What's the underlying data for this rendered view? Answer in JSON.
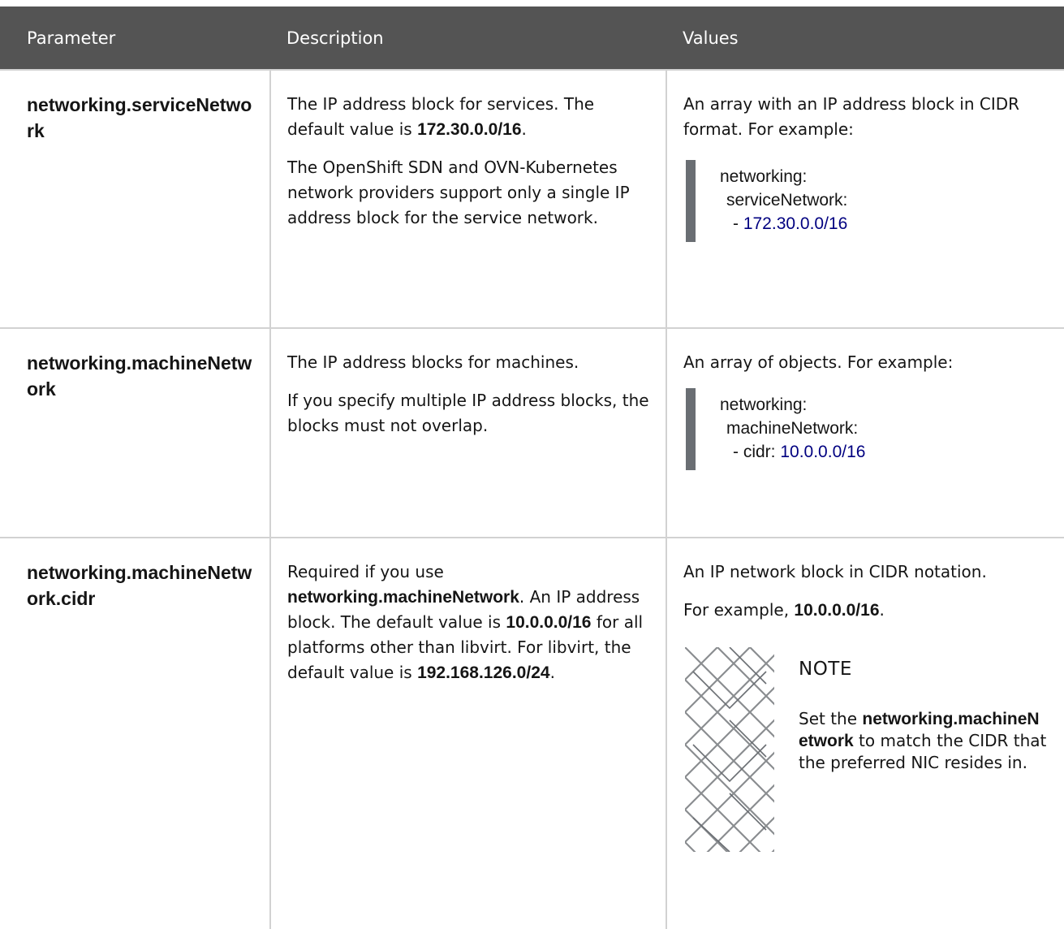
{
  "headers": {
    "parameter": "Parameter",
    "description": "Description",
    "values": "Values"
  },
  "rows": [
    {
      "param": "networking.serviceNetwork",
      "desc1_pre": "The IP address block for services. The default value is ",
      "desc1_bold": "172.30.0.0/16",
      "desc1_post": ".",
      "desc2": "The OpenShift SDN and OVN-Kubernetes network providers support only a single IP address block for the service network.",
      "value_text": "An array with an IP address block in CIDR format. For example:",
      "code": {
        "line1": "networking:",
        "line2": "serviceNetwork:",
        "line3_prefix": "- ",
        "line3_value": "172.30.0.0/16"
      }
    },
    {
      "param": "networking.machineNetwork",
      "desc1": "The IP address blocks for machines.",
      "desc2": "If you specify multiple IP address blocks, the blocks must not overlap.",
      "value_text": "An array of objects. For example:",
      "code": {
        "line1": "networking:",
        "line2": "machineNetwork:",
        "line3_prefix": "- cidr: ",
        "line3_value": "10.0.0.0/16"
      }
    },
    {
      "param": "networking.machineNetwork.cidr",
      "desc_a": "Required if you use ",
      "desc_b": "networking.machineNetwork",
      "desc_c": ". An IP address block. The default value is ",
      "desc_d": "10.0.0.0/16",
      "desc_e": " for all platforms other than libvirt. For libvirt, the default value is ",
      "desc_f": "192.168.126.0/24",
      "desc_g": ".",
      "value1": "An IP network block in CIDR notation.",
      "value2_pre": "For example, ",
      "value2_bold": "10.0.0.0/16",
      "value2_post": ".",
      "note": {
        "title": "NOTE",
        "pre": "Set the ",
        "bold": "networking.machineNetwork",
        "post": " to match the CIDR that the preferred NIC resides in."
      }
    }
  ]
}
